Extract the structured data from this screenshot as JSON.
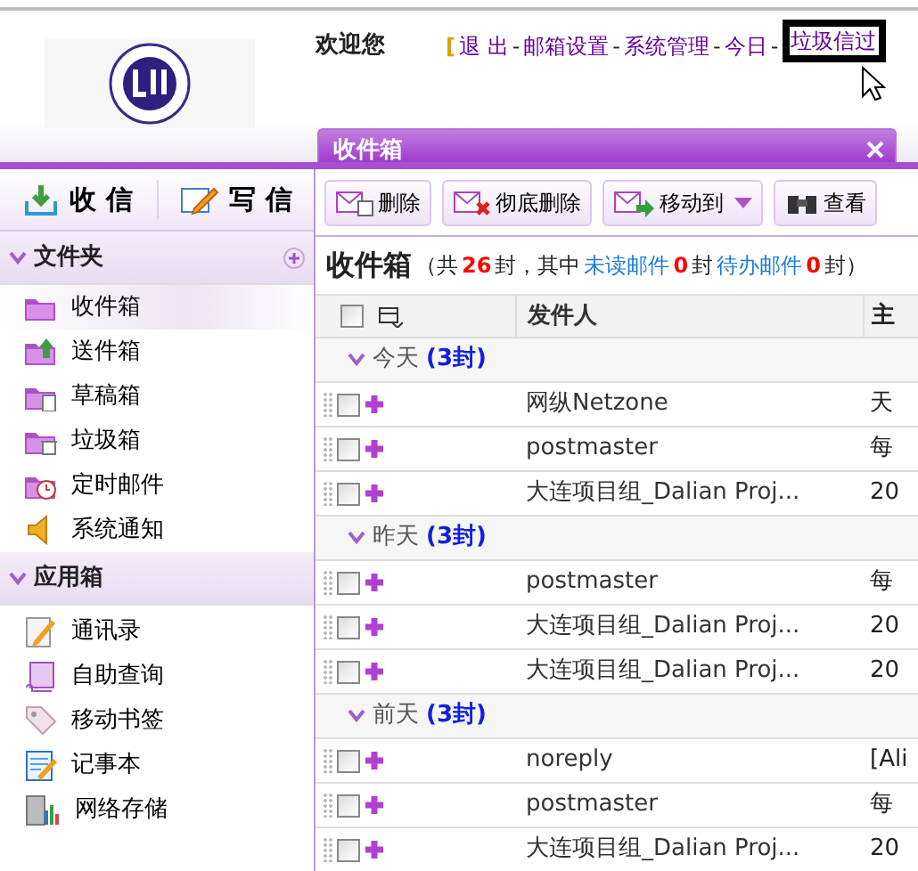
{
  "header": {
    "welcome": "欢迎您",
    "nav": [
      {
        "kind": "bracket",
        "text": "[",
        "highlighted": false
      },
      {
        "kind": "link",
        "text": "退 出",
        "highlighted": false
      },
      {
        "kind": "sep",
        "text": "-",
        "highlighted": false
      },
      {
        "kind": "link",
        "text": "邮箱设置",
        "highlighted": false
      },
      {
        "kind": "sep",
        "text": "-",
        "highlighted": false
      },
      {
        "kind": "link",
        "text": "系统管理",
        "highlighted": false
      },
      {
        "kind": "sep",
        "text": "-",
        "highlighted": false
      },
      {
        "kind": "link",
        "text": "今日",
        "highlighted": false
      },
      {
        "kind": "sep",
        "text": "-",
        "highlighted": false
      },
      {
        "kind": "link",
        "text": "垃圾信过",
        "highlighted": true
      }
    ]
  },
  "tab": {
    "title": "收件箱",
    "selected": true
  },
  "sidebar": {
    "actions": [
      {
        "kind": "receive",
        "label": "收 信"
      },
      {
        "kind": "write",
        "label": "写 信"
      }
    ],
    "sections": [
      {
        "title": "文件夹",
        "expanded": true,
        "addable": true,
        "items": [
          {
            "kind": "inbox",
            "label": "收件箱",
            "selected": true
          },
          {
            "kind": "sent",
            "label": "送件箱",
            "selected": false
          },
          {
            "kind": "drafts",
            "label": "草稿箱",
            "selected": false
          },
          {
            "kind": "trash",
            "label": "垃圾箱",
            "selected": false
          },
          {
            "kind": "scheduled",
            "label": "定时邮件",
            "selected": false
          },
          {
            "kind": "notice",
            "label": "系统通知",
            "selected": false
          }
        ]
      },
      {
        "title": "应用箱",
        "expanded": true,
        "addable": false,
        "items": [
          {
            "kind": "contacts",
            "label": "通讯录",
            "selected": false
          },
          {
            "kind": "query",
            "label": "自助查询",
            "selected": false
          },
          {
            "kind": "bookmark",
            "label": "移动书签",
            "selected": false
          },
          {
            "kind": "notepad",
            "label": "记事本",
            "selected": false
          },
          {
            "kind": "storage",
            "label": "网络存储",
            "selected": false
          }
        ]
      }
    ]
  },
  "toolbar": [
    {
      "kind": "delete",
      "label": "删除",
      "dropdown": false
    },
    {
      "kind": "purge",
      "label": "彻底删除",
      "dropdown": false
    },
    {
      "kind": "move",
      "label": "移动到",
      "dropdown": true
    },
    {
      "kind": "view",
      "label": "查看",
      "dropdown": false
    }
  ],
  "summary": [
    {
      "kind": "title",
      "text": "收件箱"
    },
    {
      "kind": "text",
      "text": "（共"
    },
    {
      "kind": "count",
      "text": "26"
    },
    {
      "kind": "text",
      "text": "封，其中"
    },
    {
      "kind": "link",
      "text": "未读邮件"
    },
    {
      "kind": "count",
      "text": "0"
    },
    {
      "kind": "text",
      "text": "封"
    },
    {
      "kind": "link",
      "text": "待办邮件"
    },
    {
      "kind": "count",
      "text": "0"
    },
    {
      "kind": "text",
      "text": "封）"
    }
  ],
  "table": {
    "select_all_checked": false,
    "columns": [
      "发件人",
      "主"
    ],
    "groups": [
      {
        "label": "今天",
        "count": "(3封)",
        "expanded": true,
        "rows": [
          {
            "sender": "网纵Netzone",
            "subject": "天",
            "checked": false
          },
          {
            "sender": "postmaster",
            "subject": "每",
            "checked": false
          },
          {
            "sender": "大连项目组_Dalian Proj...",
            "subject": "20",
            "checked": false
          }
        ]
      },
      {
        "label": "昨天",
        "count": "(3封)",
        "expanded": true,
        "rows": [
          {
            "sender": "postmaster",
            "subject": "每",
            "checked": false
          },
          {
            "sender": "大连项目组_Dalian Proj...",
            "subject": "20",
            "checked": false
          },
          {
            "sender": "大连项目组_Dalian Proj...",
            "subject": "20",
            "checked": false
          }
        ]
      },
      {
        "label": "前天",
        "count": "(3封)",
        "expanded": true,
        "rows": [
          {
            "sender": "noreply",
            "subject": "[Ali",
            "checked": false
          },
          {
            "sender": "postmaster",
            "subject": "每",
            "checked": false
          },
          {
            "sender": "大连项目组_Dalian Proj...",
            "subject": "20",
            "checked": false
          }
        ]
      }
    ]
  }
}
